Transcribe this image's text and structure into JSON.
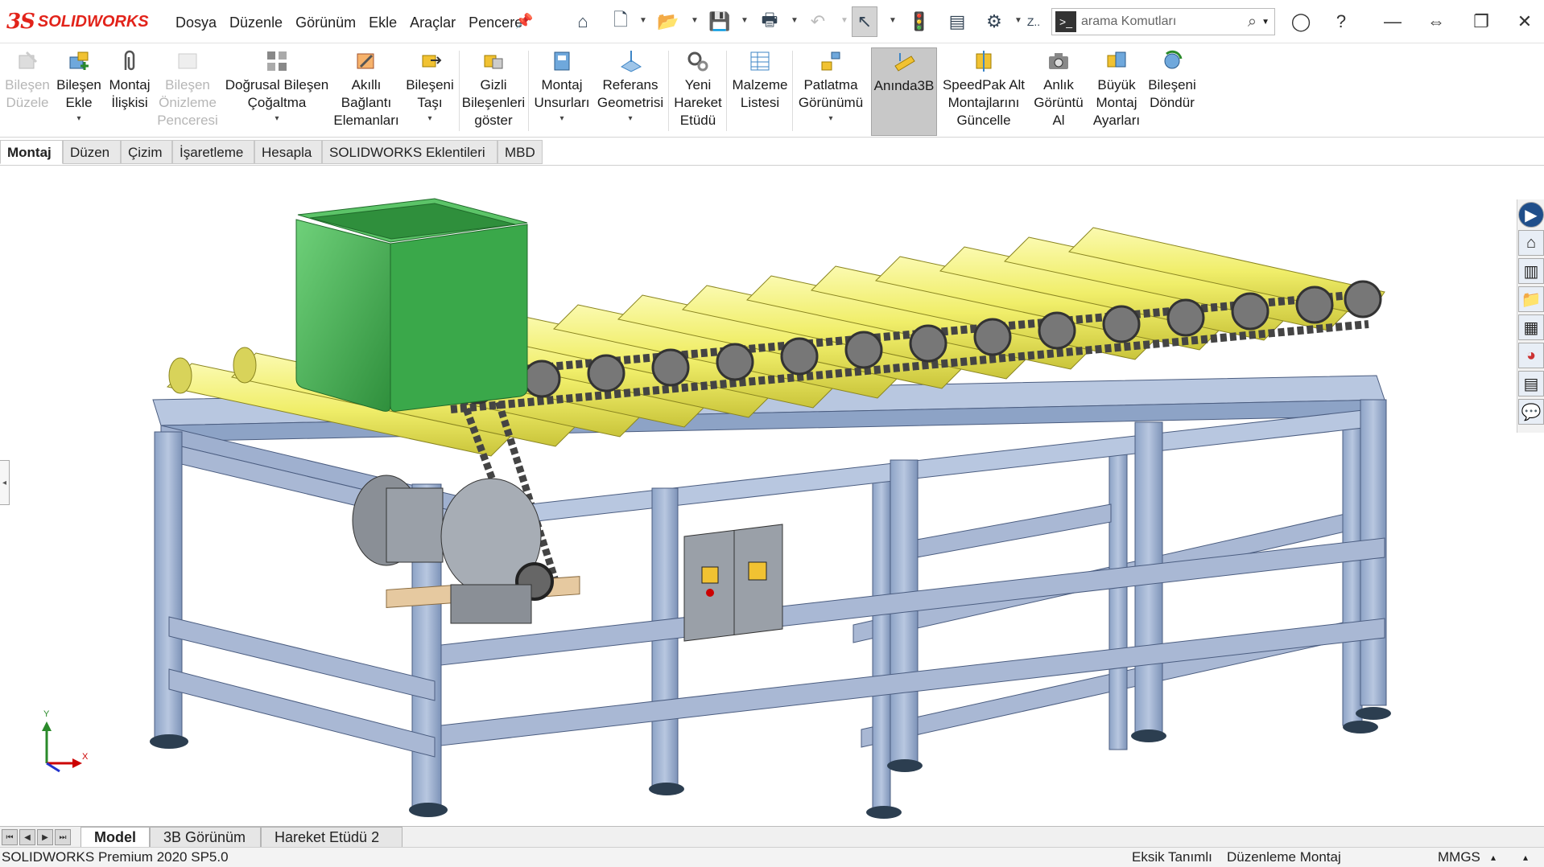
{
  "app": {
    "brand_prefix": "3S",
    "brand_name": "SOLIDWORKS"
  },
  "menu": [
    "Dosya",
    "Düzenle",
    "Görünüm",
    "Ekle",
    "Araçlar",
    "Pencere"
  ],
  "search": {
    "placeholder": "arama Komutları",
    "zoom_hint": "Z.."
  },
  "ribbon": [
    {
      "label": "Bileşen\nDüzele",
      "disabled": true
    },
    {
      "label": "Bileşen\nEkle",
      "disabled": false
    },
    {
      "label": "Montaj\nİlişkisi",
      "disabled": false
    },
    {
      "label": "Bileşen\nÖnizleme\nPenceresi",
      "disabled": true
    },
    {
      "label": "Doğrusal Bileşen\nÇoğaltma",
      "disabled": false
    },
    {
      "label": "Akıllı\nBağlantı\nElemanları",
      "disabled": false
    },
    {
      "label": "Bileşeni\nTaşı",
      "disabled": false
    },
    {
      "label": "Gizli\nBileşenleri\ngöster",
      "disabled": false
    },
    {
      "label": "Montaj\nUnsurları",
      "disabled": false
    },
    {
      "label": "Referans\nGeometrisi",
      "disabled": false
    },
    {
      "label": "Yeni\nHareket\nEtüdü",
      "disabled": false
    },
    {
      "label": "Malzeme\nListesi",
      "disabled": false
    },
    {
      "label": "Patlatma\nGörünümü",
      "disabled": false
    },
    {
      "label": "Anında3B",
      "disabled": false,
      "active": true
    },
    {
      "label": "SpeedPak Alt\nMontajlarını\nGüncelle",
      "disabled": false
    },
    {
      "label": "Anlık\nGörüntü\nAl",
      "disabled": false
    },
    {
      "label": "Büyük\nMontaj\nAyarları",
      "disabled": false
    },
    {
      "label": "Bileşeni\nDöndür",
      "disabled": false
    }
  ],
  "tabs": [
    "Montaj",
    "Düzen",
    "Çizim",
    "İşaretleme",
    "Hesapla",
    "SOLIDWORKS Eklentileri",
    "MBD"
  ],
  "triad": {
    "x": "X",
    "y": "Y"
  },
  "bottom_tabs": [
    "Model",
    "3B Görünüm",
    "Hareket Etüdü 2"
  ],
  "status": {
    "version": "SOLIDWORKS Premium 2020 SP5.0",
    "definition": "Eksik Tanımlı",
    "mode": "Düzenleme Montaj",
    "units": "MMGS"
  },
  "colors": {
    "brand": "#e2231a",
    "frame": "#a9b8d4",
    "roller": "#f0ee6a",
    "bin": "#3aa84a",
    "chain": "#555555"
  }
}
